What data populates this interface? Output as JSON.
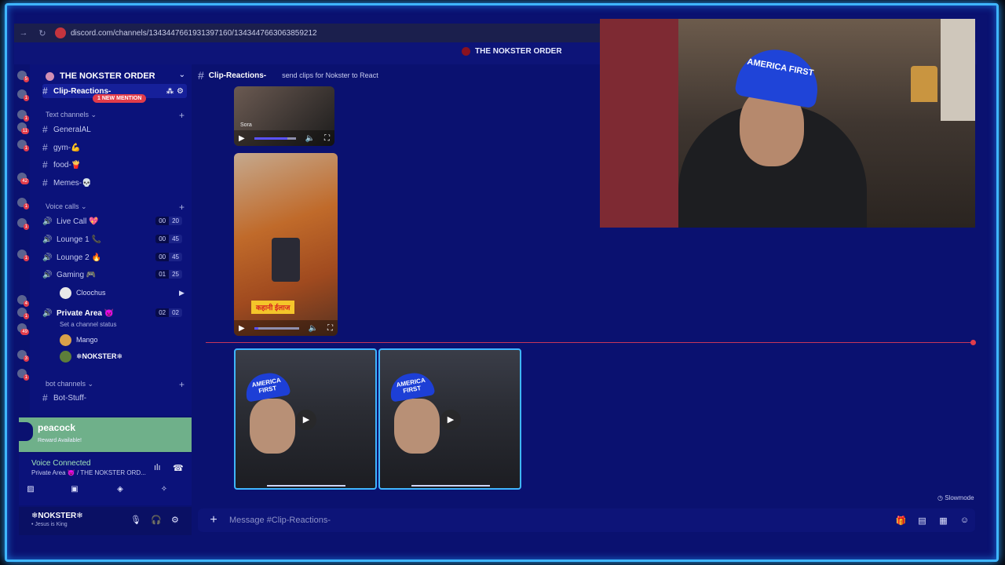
{
  "browser": {
    "url": "discord.com/channels/1343447661931397160/1343447663063859212"
  },
  "server": {
    "name": "THE NOKSTER ORDER",
    "top_label": "THE NOKSTER ORDER"
  },
  "server_rail_badges": [
    "5",
    "1",
    "1",
    "11",
    "1",
    "42",
    "1",
    "1",
    "1",
    "4",
    "1",
    "49",
    "3",
    "1"
  ],
  "sidebar": {
    "active_channel": "Clip-Reactions-",
    "mention_label": "1 NEW MENTION",
    "categories": {
      "text": "Text channels",
      "voice": "Voice calls",
      "bot": "bot channels"
    },
    "text_channels": [
      "GeneralAL",
      "gym-💪",
      "food-🍟",
      "Memes-💀"
    ],
    "voice_channels": [
      {
        "name": "Live Call 💖",
        "c1": "00",
        "c2": "20"
      },
      {
        "name": "Lounge 1 📞",
        "c1": "00",
        "c2": "45"
      },
      {
        "name": "Lounge 2 🔥",
        "c1": "00",
        "c2": "45"
      },
      {
        "name": "Gaming 🎮",
        "c1": "01",
        "c2": "25"
      }
    ],
    "gaming_member": "Cloochus",
    "private_area": {
      "name": "Private Area 👿",
      "c1": "02",
      "c2": "02",
      "status": "Set a channel status"
    },
    "private_members": [
      "Mango",
      "❄NOKSTER❄"
    ],
    "bot_channel": "Bot-Stuff-"
  },
  "promo": {
    "title": "peacock",
    "subtitle": "Reward Available!"
  },
  "voice_panel": {
    "status": "Voice Connected",
    "location": "Private Area 👿 / THE NOKSTER ORD..."
  },
  "user_panel": {
    "name": "❄NOKSTER❄",
    "status": "• Jesus is King"
  },
  "channel_header": {
    "name": "Clip-Reactions-",
    "topic": "send clips for Nokster to React"
  },
  "media": {
    "video1_watermark": "Sora",
    "video2_caption": "कहानी ईलाज",
    "thumb_caption": "AMERICA FIRST"
  },
  "footer": {
    "slowmode": "Slowmode",
    "message_placeholder": "Message #Clip-Reactions-"
  },
  "webcam": {
    "hat_text": "AMERICA FIRST"
  },
  "colors": {
    "accent": "#3fb6ff",
    "background": "#0a1170",
    "mention": "#e23c4a",
    "peacock": "#6fb08a"
  }
}
